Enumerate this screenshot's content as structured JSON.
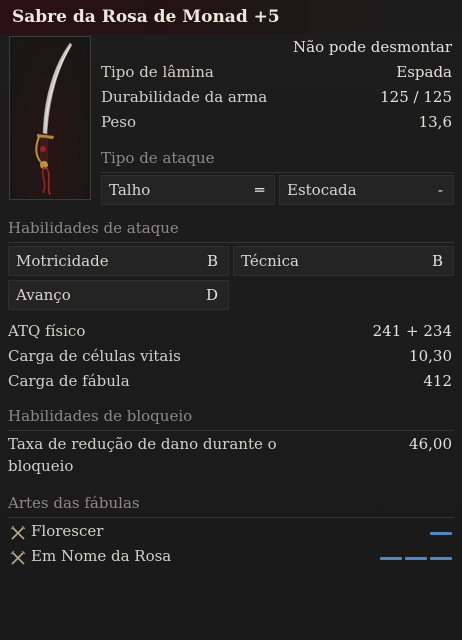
{
  "title": "Sabre da Rosa de Monad +5",
  "dismantle_note": "Não pode desmontar",
  "base_stats": [
    {
      "label": "Tipo de lâmina",
      "value": "Espada"
    },
    {
      "label": "Durabilidade da arma",
      "value": "125 / 125"
    },
    {
      "label": "Peso",
      "value": "13,6"
    }
  ],
  "attack_type": {
    "heading": "Tipo de ataque",
    "items": [
      {
        "label": "Talho",
        "value": "═"
      },
      {
        "label": "Estocada",
        "value": "-"
      }
    ]
  },
  "attack_abilities": {
    "heading": "Habilidades de ataque",
    "items": [
      {
        "label": "Motricidade",
        "value": "B"
      },
      {
        "label": "Técnica",
        "value": "B"
      },
      {
        "label": "Avanço",
        "value": "D"
      }
    ]
  },
  "attack_stats": [
    {
      "label": "ATQ físico",
      "value": "241 + 234"
    },
    {
      "label": "Carga de células vitais",
      "value": "10,30"
    },
    {
      "label": "Carga de fábula",
      "value": "412"
    }
  ],
  "block_abilities": {
    "heading": "Habilidades de bloqueio",
    "label_line1": "Taxa de redução de dano durante o",
    "label_line2": "bloqueio",
    "value": "46,00"
  },
  "fable_arts": {
    "heading": "Artes das fábulas",
    "items": [
      {
        "name": "Florescer",
        "icon": "crossed-swords-icon",
        "cost": 1
      },
      {
        "name": "Em Nome da Rosa",
        "icon": "crossed-swords-icon",
        "cost": 3
      }
    ]
  },
  "colors": {
    "accent_blue": "#4f86c4",
    "title_red": "#2b1012"
  }
}
